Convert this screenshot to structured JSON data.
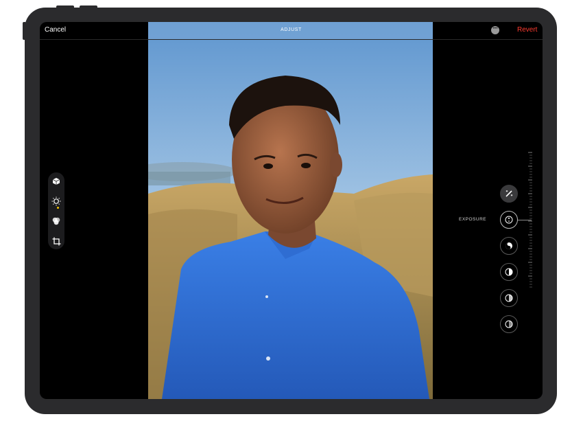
{
  "topbar": {
    "cancel_label": "Cancel",
    "title": "ADJUST",
    "more_icon": "ellipsis-circle-icon",
    "revert_label": "Revert",
    "revert_color": "#ff3b30"
  },
  "tools": [
    {
      "name": "live-photo",
      "icon": "cube-icon"
    },
    {
      "name": "adjust",
      "icon": "dial-icon",
      "active": true
    },
    {
      "name": "filters",
      "icon": "filters-icon"
    },
    {
      "name": "crop",
      "icon": "crop-icon"
    }
  ],
  "adjustments": {
    "selected_label": "EXPOSURE",
    "items": [
      {
        "name": "auto-enhance",
        "icon": "magic-wand-icon"
      },
      {
        "name": "exposure",
        "icon": "exposure-icon",
        "selected": true
      },
      {
        "name": "brilliance",
        "icon": "brilliance-icon"
      },
      {
        "name": "highlights",
        "icon": "highlights-icon"
      },
      {
        "name": "shadows",
        "icon": "shadows-icon"
      },
      {
        "name": "contrast",
        "icon": "contrast-icon"
      }
    ]
  },
  "colors": {
    "accent_yellow": "#f5c400",
    "revert_red": "#ff3b30",
    "shirt_blue": "#2d6fd8"
  }
}
